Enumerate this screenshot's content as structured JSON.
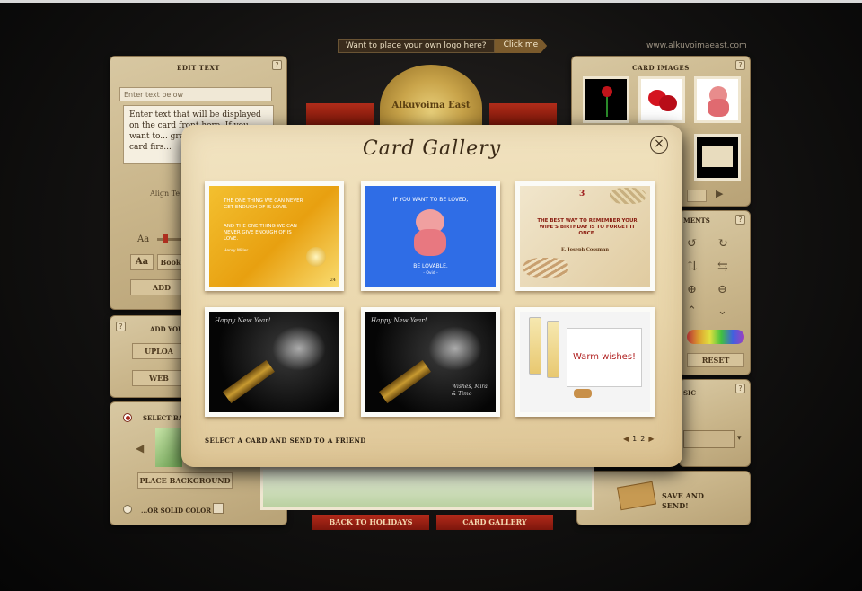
{
  "promo": {
    "question": "Want to place your own logo here?",
    "click": "Click me"
  },
  "site_url": "www.alkuvoimaeast.com",
  "seal_text": "Alkuvoima East",
  "left": {
    "edit_text_title": "EDIT TEXT",
    "placeholder": "Enter text below",
    "body_text": "Enter text that will be displayed on the card front here. If you want to... greeting on th... your card firs...",
    "align_label": "Align Te",
    "font_btn_1": "Aa",
    "font_btn_2": "Book",
    "add_btn": "ADD",
    "add_your_label": "ADD YOU",
    "upload_btn": "UPLOA",
    "web_btn": "WEB",
    "select_bg_label": "SELECT BA",
    "place_bg_btn": "PLACE BACKGROUND",
    "solid_color_label": "...OR SOLID COLOR"
  },
  "right": {
    "card_images_title": "CARD IMAGES",
    "adjust_title": "MENTS",
    "reset_btn": "RESET",
    "music_title": "SIC",
    "save_send": "SAVE AND SEND!"
  },
  "bottom": {
    "back_btn": "BACK TO HOLIDAYS",
    "gallery_btn": "CARD GALLERY"
  },
  "modal": {
    "title": "Card Gallery",
    "close": "×",
    "footer_label": "SELECT A CARD AND SEND TO A FRIEND",
    "pages": [
      "1",
      "2"
    ],
    "prev": "◀",
    "next": "▶",
    "cards": [
      {
        "line1": "THE ONE THING WE CAN NEVER GET ENOUGH OF IS LOVE.",
        "line2": "AND THE ONE THING WE CAN NEVER GIVE ENOUGH OF IS LOVE.",
        "author": "Henry Miller",
        "num": "24"
      },
      {
        "line1": "IF YOU WANT TO BE LOVED,",
        "line2": "BE LOVABLE.",
        "author": "- Ovid -"
      },
      {
        "num": "3",
        "line1": "THE BEST WAY TO REMEMBER YOUR WIFE'S BIRTHDAY IS TO FORGET IT ONCE.",
        "author": "E. Joseph Cossman"
      },
      {
        "line1": "Happy New Year!"
      },
      {
        "line1": "Happy New Year!",
        "line2": "Wishes, Mira & Timo"
      },
      {
        "line1": "Warm wishes!"
      }
    ]
  },
  "colors": {
    "accent_red": "#a7241a",
    "parchment": "#ecdcb6",
    "card_blue": "#2f6de6"
  }
}
